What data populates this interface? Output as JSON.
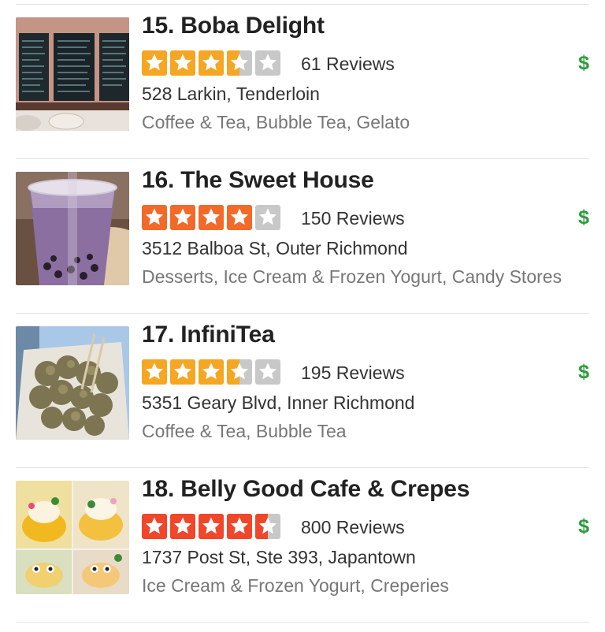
{
  "colors": {
    "star_orange_light": "#f5a623",
    "star_orange_dark": "#f26a2a",
    "star_red": "#f0462a",
    "star_empty": "#c8c8c8",
    "price_green": "#2a9d3a"
  },
  "businesses": [
    {
      "title": "15. Boba Delight",
      "rating": 3.5,
      "reviews": "61 Reviews",
      "price": "$",
      "address": "528 Larkin, Tenderloin",
      "categories": "Coffee & Tea, Bubble Tea, Gelato",
      "photo": "chalkboard-menu-photo"
    },
    {
      "title": "16. The Sweet House",
      "rating": 4,
      "reviews": "150 Reviews",
      "price": "$",
      "address": "3512 Balboa St, Outer Richmond",
      "categories": "Desserts, Ice Cream & Frozen Yogurt, Candy Stores",
      "photo": "taro-bubble-tea-photo"
    },
    {
      "title": "17. InfiniTea",
      "rating": 3.5,
      "reviews": "195 Reviews",
      "price": "$",
      "address": "5351 Geary Blvd, Inner Richmond",
      "categories": "Coffee & Tea, Bubble Tea",
      "photo": "popcorn-chicken-photo"
    },
    {
      "title": "18. Belly Good Cafe & Crepes",
      "rating": 4.5,
      "reviews": "800 Reviews",
      "price": "$",
      "address": "1737 Post St, Ste 393, Japantown",
      "categories": "Ice Cream & Frozen Yogurt, Creperies",
      "photo": "crepe-collage-photo"
    }
  ]
}
